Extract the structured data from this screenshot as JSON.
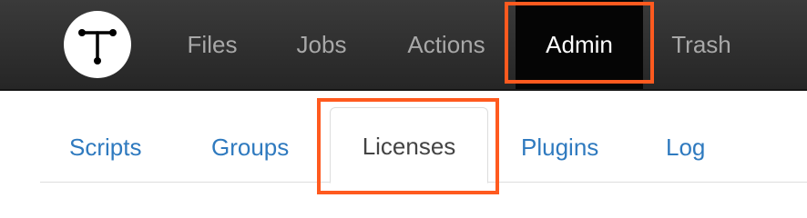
{
  "topnav": {
    "logo_icon": "tee-junction-logo-icon",
    "items": [
      {
        "label": "Files"
      },
      {
        "label": "Jobs"
      },
      {
        "label": "Actions"
      },
      {
        "label": "Admin",
        "active": true
      },
      {
        "label": "Trash"
      }
    ]
  },
  "subnav": {
    "tabs": [
      {
        "label": "Scripts"
      },
      {
        "label": "Groups"
      },
      {
        "label": "Licenses",
        "active": true
      },
      {
        "label": "Plugins"
      },
      {
        "label": "Log"
      }
    ]
  },
  "colors": {
    "topbar_bg": "#2e2e2e",
    "active_top_bg": "#050505",
    "highlight_border": "#ff5a1f",
    "link": "#2f7abf",
    "active_tab_text": "#444444"
  }
}
